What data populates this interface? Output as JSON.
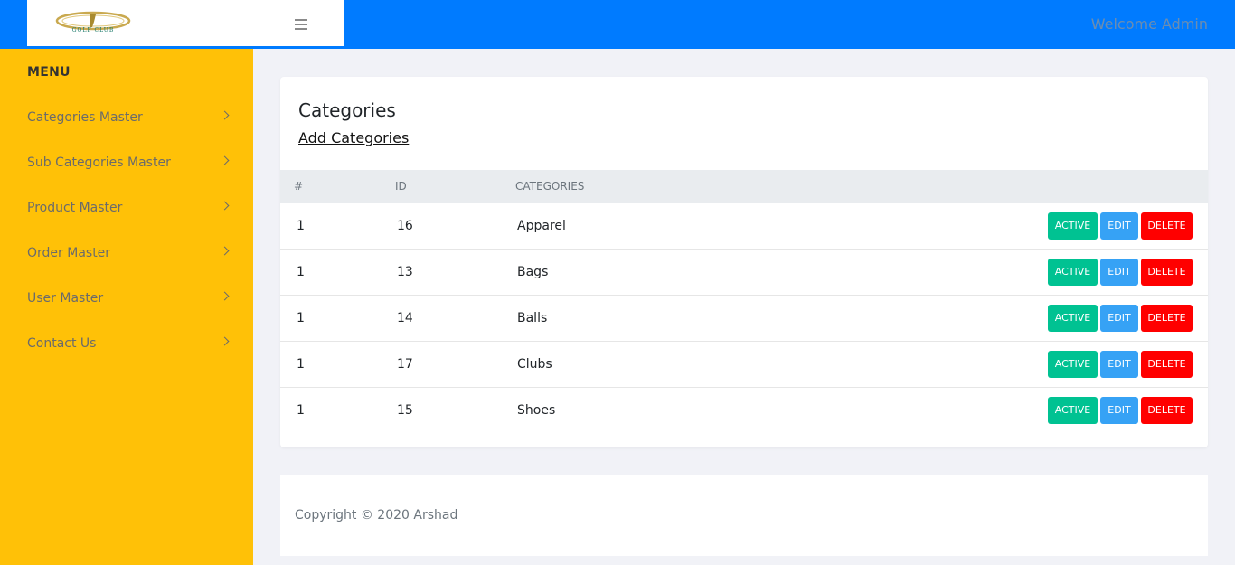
{
  "header": {
    "logo_text": "GOLF CLUB",
    "welcome": "Welcome Admin"
  },
  "sidebar": {
    "title": "MENU",
    "items": [
      {
        "label": "Categories Master"
      },
      {
        "label": "Sub Categories Master"
      },
      {
        "label": "Product Master"
      },
      {
        "label": "Order Master"
      },
      {
        "label": "User Master"
      },
      {
        "label": "Contact Us"
      }
    ]
  },
  "main": {
    "title": "Categories",
    "add_link": "Add Categories",
    "table": {
      "headers": [
        "#",
        "ID",
        "CATEGORIES"
      ],
      "rows": [
        {
          "num": "1",
          "id": "16",
          "name": "Apparel"
        },
        {
          "num": "1",
          "id": "13",
          "name": "Bags"
        },
        {
          "num": "1",
          "id": "14",
          "name": "Balls"
        },
        {
          "num": "1",
          "id": "17",
          "name": "Clubs"
        },
        {
          "num": "1",
          "id": "15",
          "name": "Shoes"
        }
      ],
      "actions": {
        "active": "ACTIVE",
        "edit": "EDIT",
        "delete": "DELETE"
      }
    }
  },
  "footer": {
    "copyright": "Copyright © 2020 Arshad"
  },
  "colors": {
    "topbar": "#007bff",
    "sidebar": "#ffc107",
    "active_btn": "#00c292",
    "edit_btn": "#36a2f5",
    "delete_btn": "#ff0000"
  }
}
